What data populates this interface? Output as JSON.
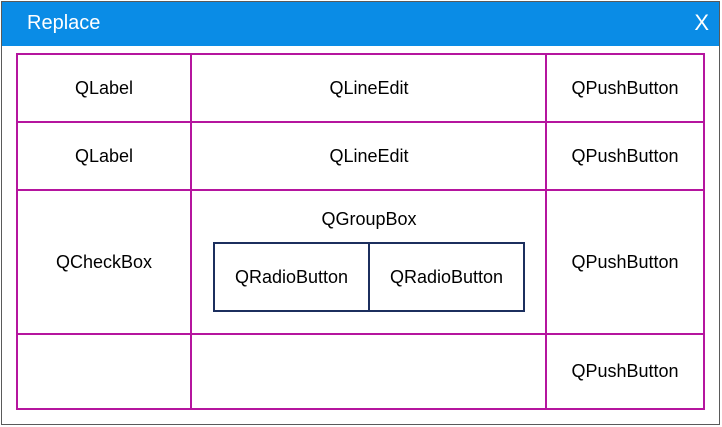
{
  "window": {
    "title": "Replace",
    "close_label": "X"
  },
  "grid": {
    "row1": {
      "label": "QLabel",
      "edit": "QLineEdit",
      "button": "QPushButton"
    },
    "row2": {
      "label": "QLabel",
      "edit": "QLineEdit",
      "button": "QPushButton"
    },
    "row3": {
      "checkbox": "QCheckBox",
      "groupbox": {
        "title": "QGroupBox",
        "radios": [
          "QRadioButton",
          "QRadioButton"
        ]
      },
      "button": "QPushButton"
    },
    "row4": {
      "button": "QPushButton"
    }
  },
  "colors": {
    "titlebar": "#0a8ce6",
    "cell_border": "#b5159e",
    "groupbox_border": "#1c2f5e"
  }
}
